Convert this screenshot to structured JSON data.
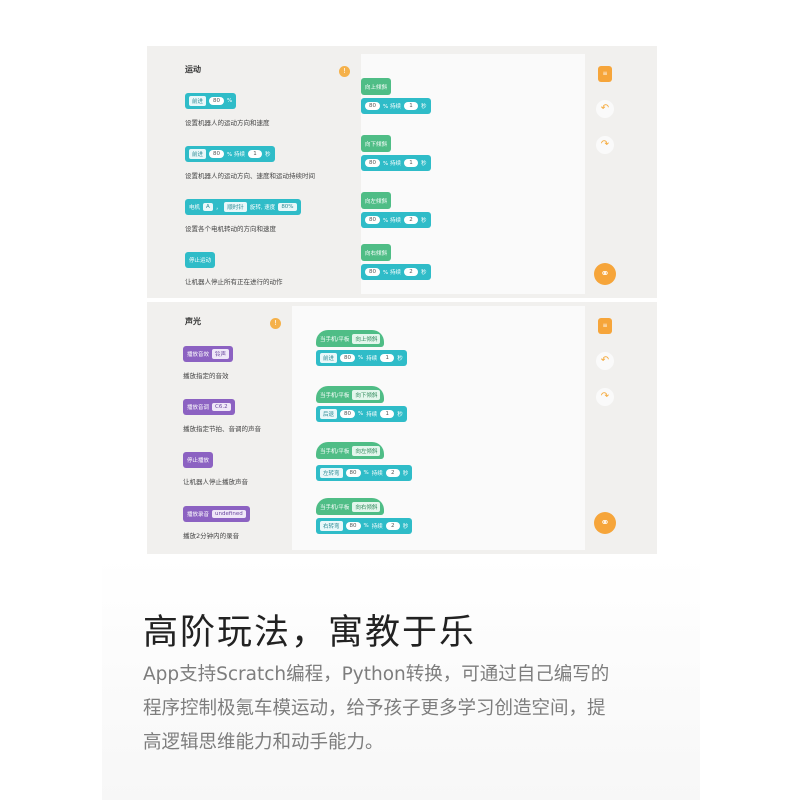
{
  "colors": {
    "accent": "#f6a53a",
    "motion": "#2fbcc8",
    "sound": "#8c62c2",
    "event": "#4fbd86"
  },
  "motion_section": {
    "title": "运动",
    "blocks": [
      {
        "parts": [
          "前进",
          "80",
          "%"
        ],
        "desc": "设置机器人的运动方向和速度"
      },
      {
        "parts": [
          "前进",
          "80",
          "% 持续",
          "1",
          "秒"
        ],
        "desc": "设置机器人的运动方向、速度和运动持续时间"
      },
      {
        "parts": [
          "电机",
          "A",
          "，",
          "顺时针",
          "旋转, 速度",
          "80%"
        ],
        "desc": "设置各个电机转动的方向和速度"
      },
      {
        "parts": [
          "停止运动"
        ],
        "desc": "让机器人停止所有正在进行的动作"
      }
    ],
    "scripts": [
      {
        "hat": "向上倾斜",
        "body": [
          "80",
          "% 持续",
          "1",
          "秒"
        ]
      },
      {
        "hat": "向下倾斜",
        "body": [
          "80",
          "% 持续",
          "1",
          "秒"
        ]
      },
      {
        "hat": "向左倾斜",
        "body": [
          "80",
          "% 持续",
          "2",
          "秒"
        ]
      },
      {
        "hat": "向右倾斜",
        "body": [
          "80",
          "% 持续",
          "2",
          "秒"
        ]
      }
    ]
  },
  "sound_section": {
    "title": "声光",
    "blocks": [
      {
        "parts": [
          "播放音效",
          "铃声"
        ],
        "desc": "播放指定的音效"
      },
      {
        "parts": [
          "播放音调",
          "C6.2"
        ],
        "desc": "播放指定节拍、音调的声音"
      },
      {
        "parts": [
          "停止播放"
        ],
        "desc": "让机器人停止播放声音"
      },
      {
        "parts": [
          "播放录音",
          "undefined"
        ],
        "desc": "播放2分钟内的录音"
      }
    ],
    "scripts": [
      {
        "hat": [
          "当手机/平板",
          "向上倾斜"
        ],
        "body": [
          "前进",
          "80",
          "%",
          "持续",
          "1",
          "秒"
        ]
      },
      {
        "hat": [
          "当手机/平板",
          "向下倾斜"
        ],
        "body": [
          "后退",
          "80",
          "%",
          "持续",
          "1",
          "秒"
        ]
      },
      {
        "hat": [
          "当手机/平板",
          "向左倾斜"
        ],
        "body": [
          "左转弯",
          "80",
          "%",
          "持续",
          "2",
          "秒"
        ]
      },
      {
        "hat": [
          "当手机/平板",
          "向右倾斜"
        ],
        "body": [
          "右转弯",
          "80",
          "%",
          "持续",
          "2",
          "秒"
        ]
      }
    ]
  },
  "icons": {
    "info": "info-icon",
    "doc": "document-icon",
    "undo": "undo-icon",
    "redo": "redo-icon",
    "share": "share-icon"
  },
  "headline": "高阶玩法，寓教于乐",
  "paragraph": [
    "App支持Scratch编程，Python转换，可通过自己编写的",
    "程序控制极氪车模运动，给予孩子更多学习创造空间，提",
    "高逻辑思维能力和动手能力。"
  ]
}
